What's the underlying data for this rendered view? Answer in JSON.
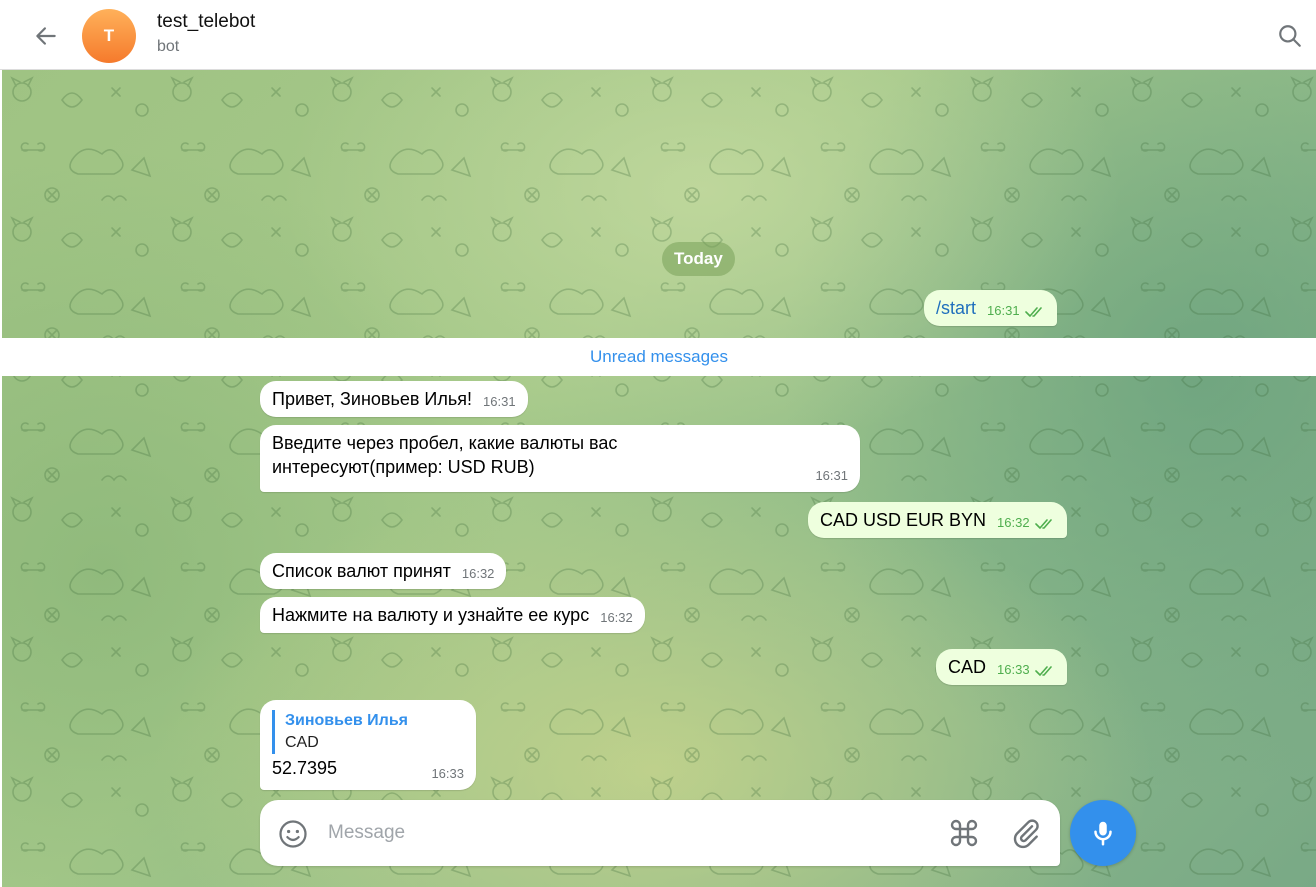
{
  "header": {
    "avatar_letter": "T",
    "title": "test_telebot",
    "status": "bot"
  },
  "chat": {
    "date_label": "Today",
    "unread_label": "Unread messages",
    "messages": [
      {
        "direction": "out",
        "text": "/start",
        "time": "16:31",
        "read": true
      },
      {
        "direction": "in",
        "text": "Привет, Зиновьев Илья!",
        "time": "16:31"
      },
      {
        "direction": "in",
        "text_line1": "Введите через пробел, какие валюты вас",
        "text_line2": "интересуют(пример: USD RUB)",
        "time": "16:31"
      },
      {
        "direction": "out",
        "text": "CAD USD EUR BYN",
        "time": "16:32",
        "read": true
      },
      {
        "direction": "in",
        "text": "Список валют принят",
        "time": "16:32"
      },
      {
        "direction": "in",
        "text": "Нажмите на валюту и узнайте ее курс",
        "time": "16:32"
      },
      {
        "direction": "out",
        "text": "CAD",
        "time": "16:33",
        "read": true
      },
      {
        "direction": "in",
        "reply_name": "Зиновьев Илья",
        "reply_text": "CAD",
        "text": "52.7395",
        "time": "16:33"
      }
    ]
  },
  "composer": {
    "placeholder": "Message"
  },
  "colors": {
    "accent": "#3390ec",
    "outgoing_bubble": "#eeffde",
    "read_check": "#4fae4e"
  },
  "icons": [
    "back-arrow-icon",
    "search-icon",
    "emoji-icon",
    "command-icon",
    "paperclip-icon",
    "microphone-icon",
    "double-check-icon"
  ]
}
